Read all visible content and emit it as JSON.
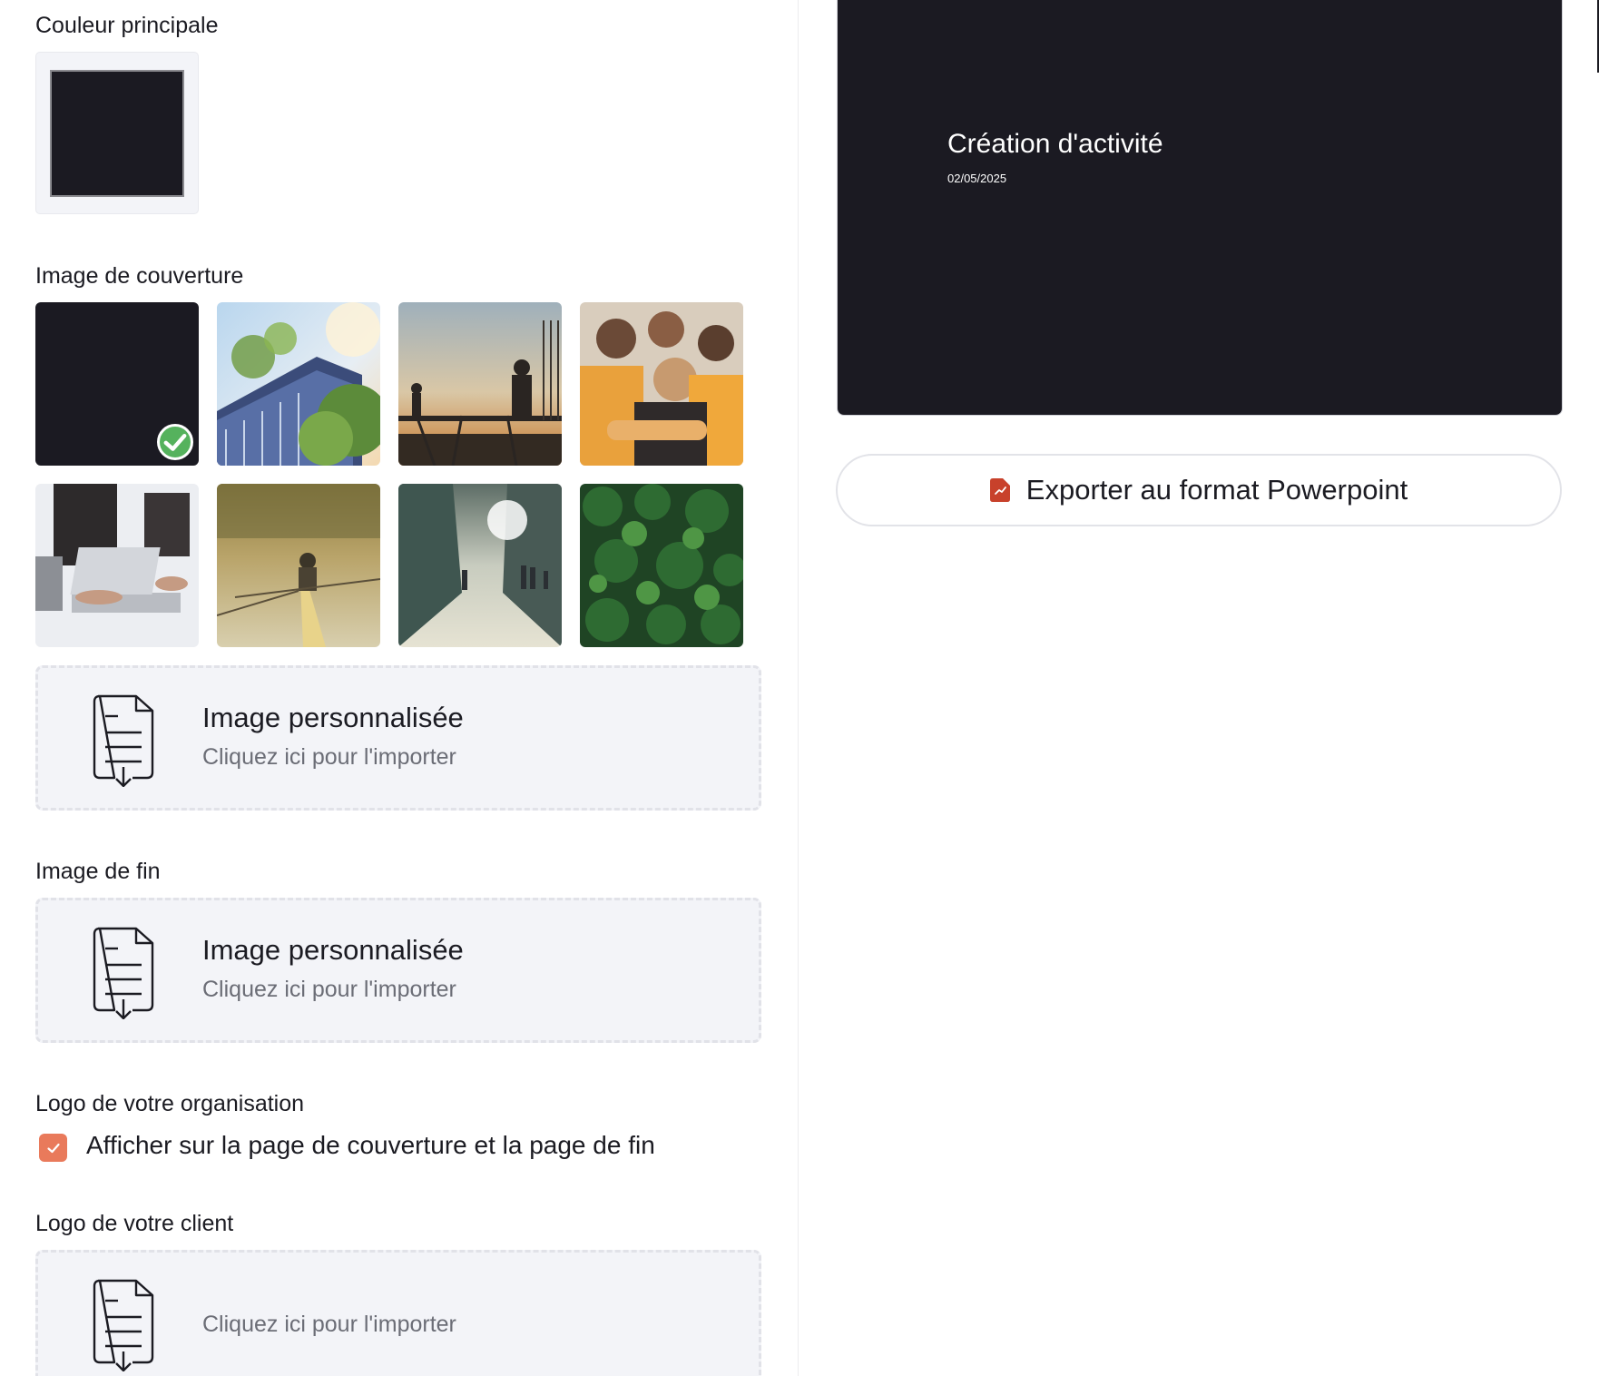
{
  "main_color": {
    "label": "Couleur principale",
    "value": "#1b1a22"
  },
  "cover": {
    "label": "Image de couverture",
    "images": [
      {
        "name": "solid-dark",
        "selected": true
      },
      {
        "name": "building-photo",
        "selected": false
      },
      {
        "name": "construction-workers-photo",
        "selected": false
      },
      {
        "name": "team-huddle-photo",
        "selected": false
      },
      {
        "name": "laptop-meeting-photo",
        "selected": false
      },
      {
        "name": "rowing-photo",
        "selected": false
      },
      {
        "name": "city-street-photo",
        "selected": false
      },
      {
        "name": "forest-aerial-photo",
        "selected": false
      }
    ],
    "custom": {
      "title": "Image personnalisée",
      "subtitle": "Cliquez ici pour l'importer"
    }
  },
  "end_image": {
    "label": "Image de fin",
    "custom": {
      "title": "Image personnalisée",
      "subtitle": "Cliquez ici pour l'importer"
    }
  },
  "org_logo": {
    "label": "Logo de votre organisation",
    "checkbox_label": "Afficher sur la page de couverture et la page de fin",
    "checked": true
  },
  "client_logo": {
    "label": "Logo de votre client",
    "subtitle": "Cliquez ici pour l'importer"
  },
  "preview": {
    "title": "Création d'activité",
    "date": "02/05/2025",
    "background": "#1b1a22"
  },
  "export": {
    "label": "Exporter au format Powerpoint",
    "icon": "powerpoint-file-icon",
    "icon_color": "#c8412b"
  },
  "colors": {
    "accent": "#e97a5b",
    "success": "#55b25d",
    "dropzone_bg": "#f3f4f8"
  }
}
